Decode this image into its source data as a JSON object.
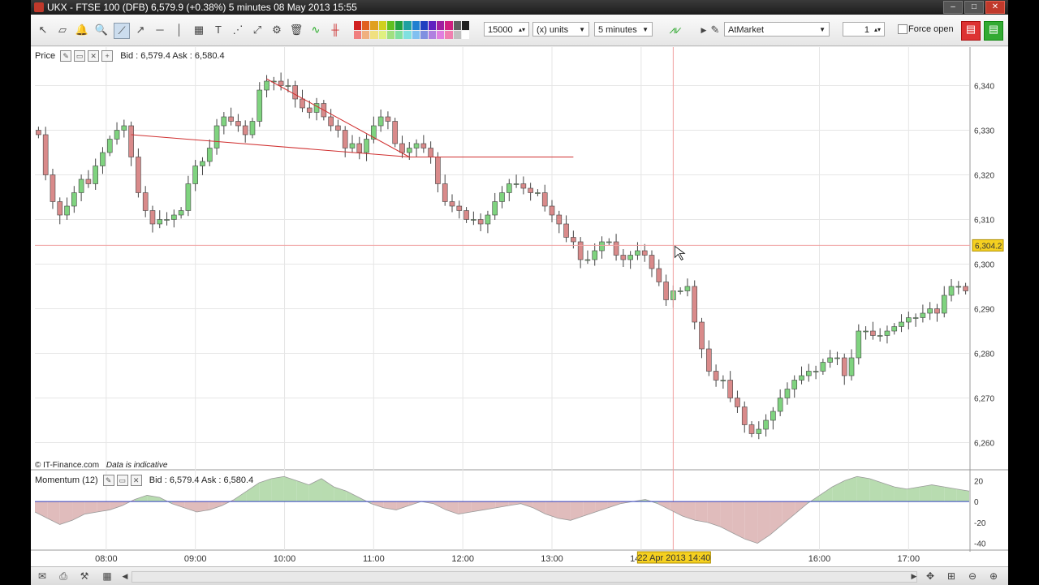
{
  "window": {
    "title": "UKX - FTSE 100 (DFB)    6,579.9 (+0.38%)    5 minutes  08 May 2013 15:55"
  },
  "toolbar": {
    "quantity": "15000",
    "units": "(x) units",
    "timeframe": "5 minutes",
    "order_type": "AtMarket",
    "count": "1",
    "force_open": "Force open"
  },
  "price_panel": {
    "label": "Price",
    "bidask": "Bid : 6,579.4  Ask : 6,580.4",
    "watermark_site": "© IT-Finance.com",
    "watermark_note": "Data is indicative",
    "current_label": "6,304.2"
  },
  "momentum_panel": {
    "label": "Momentum (12)",
    "bidask": "Bid : 6,579.4  Ask : 6,580.4"
  },
  "crosshair_label": "22 Apr 2013 14:40",
  "colors": {
    "up": "#7fd37f",
    "down": "#d98a8a",
    "grid": "#e6e6e6",
    "trendline": "#d03030",
    "crosshair": "#f0a0a0",
    "label_bg": "#f5d020"
  },
  "chart_data": {
    "type": "candlestick",
    "price_axis": {
      "min": 6255,
      "max": 6345,
      "ticks": [
        "6,340",
        "6,330",
        "6,320",
        "6,310",
        "6,300",
        "6,290",
        "6,280",
        "6,270",
        "6,260"
      ]
    },
    "time_axis": {
      "ticks": [
        "08:00",
        "09:00",
        "10:00",
        "11:00",
        "12:00",
        "13:00",
        "14:00",
        "16:00",
        "17:00"
      ]
    },
    "momentum_axis": {
      "ticks": [
        "20",
        "0",
        "-20",
        "-40"
      ]
    },
    "closes": [
      6329,
      6320,
      6314,
      6311,
      6313,
      6316,
      6319,
      6318,
      6322,
      6325,
      6328,
      6330,
      6331,
      6324,
      6316,
      6312,
      6309,
      6310,
      6310,
      6311,
      6312,
      6318,
      6322,
      6323,
      6326,
      6331,
      6333,
      6332,
      6331,
      6329,
      6332,
      6339,
      6341,
      6341,
      6340,
      6340,
      6337,
      6335,
      6334,
      6336,
      6333,
      6331,
      6330,
      6326,
      6327,
      6325,
      6328,
      6331,
      6333,
      6332,
      6327,
      6325,
      6326,
      6327,
      6326,
      6324,
      6318,
      6314,
      6313,
      6312,
      6310,
      6310,
      6309,
      6311,
      6314,
      6316,
      6318,
      6318,
      6317,
      6316,
      6316,
      6313,
      6311,
      6309,
      6306,
      6305,
      6301,
      6301,
      6303,
      6305,
      6305,
      6302,
      6301,
      6302,
      6303,
      6302,
      6299,
      6296,
      6292,
      6294,
      6294,
      6295,
      6287,
      6281,
      6276,
      6274,
      6274,
      6270,
      6268,
      6264,
      6262,
      6263,
      6265,
      6267,
      6270,
      6272,
      6274,
      6275,
      6276,
      6276,
      6278,
      6279,
      6279,
      6275,
      6279,
      6285,
      6285,
      6284,
      6284,
      6285,
      6286,
      6287,
      6288,
      6288,
      6289,
      6290,
      6289,
      6293,
      6295,
      6295,
      6294
    ],
    "momentum": [
      -10,
      -16,
      -22,
      -18,
      -12,
      -10,
      -8,
      -4,
      2,
      6,
      4,
      -2,
      -6,
      -10,
      -8,
      -4,
      2,
      10,
      18,
      22,
      24,
      20,
      16,
      22,
      14,
      10,
      4,
      -2,
      -6,
      -8,
      -4,
      0,
      -2,
      -8,
      -12,
      -10,
      -8,
      -6,
      -4,
      -2,
      -6,
      -12,
      -16,
      -18,
      -14,
      -10,
      -6,
      -2,
      0,
      2,
      -2,
      -8,
      -14,
      -18,
      -20,
      -24,
      -30,
      -36,
      -40,
      -32,
      -22,
      -12,
      -2,
      6,
      14,
      20,
      24,
      22,
      18,
      14,
      12,
      14,
      16,
      14,
      12,
      10
    ],
    "trendlines": [
      {
        "from": [
          6341.5,
          32
        ],
        "to": [
          6324,
          52
        ]
      },
      {
        "from": [
          6329,
          13
        ],
        "to": [
          6324,
          52
        ]
      },
      {
        "from": [
          6324,
          52
        ],
        "to": [
          6324,
          75
        ]
      }
    ],
    "current_price": 6304.2
  }
}
